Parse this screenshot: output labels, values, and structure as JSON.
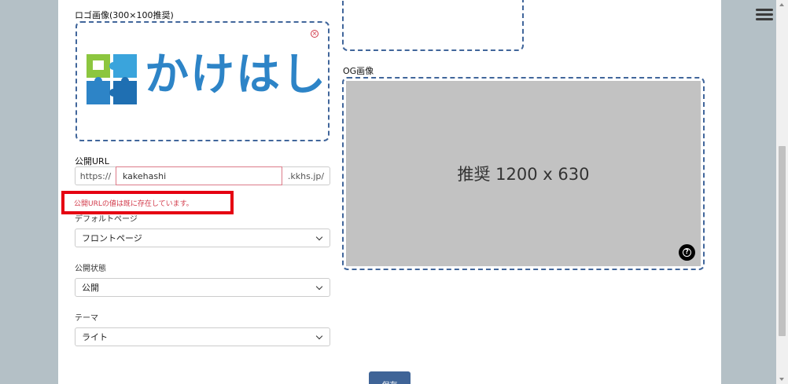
{
  "form": {
    "logo_label": "ロゴ画像(300×100推奨)",
    "logo_text": "かけはし",
    "og_label": "OG画像",
    "og_placeholder": "推奨 1200 x 630",
    "url_label": "公開URL",
    "url_prefix": "https://",
    "url_value": "kakehashi",
    "url_suffix": ".kkhs.jp/",
    "url_error": "公開URLの値は既に存在しています。",
    "default_page_label": "デフォルトページ",
    "default_page_value": "フロントページ",
    "status_label": "公開状態",
    "status_value": "公開",
    "theme_label": "テーマ",
    "theme_value": "ライト",
    "save_label": "保存"
  },
  "colors": {
    "accent": "#41669b",
    "error": "#e50012",
    "logo_blue": "#2d84c7",
    "logo_green": "#8cc63f"
  },
  "icons": {
    "close": "close-circle-icon",
    "help": "help-circle-icon",
    "menu": "hamburger-menu-icon"
  }
}
